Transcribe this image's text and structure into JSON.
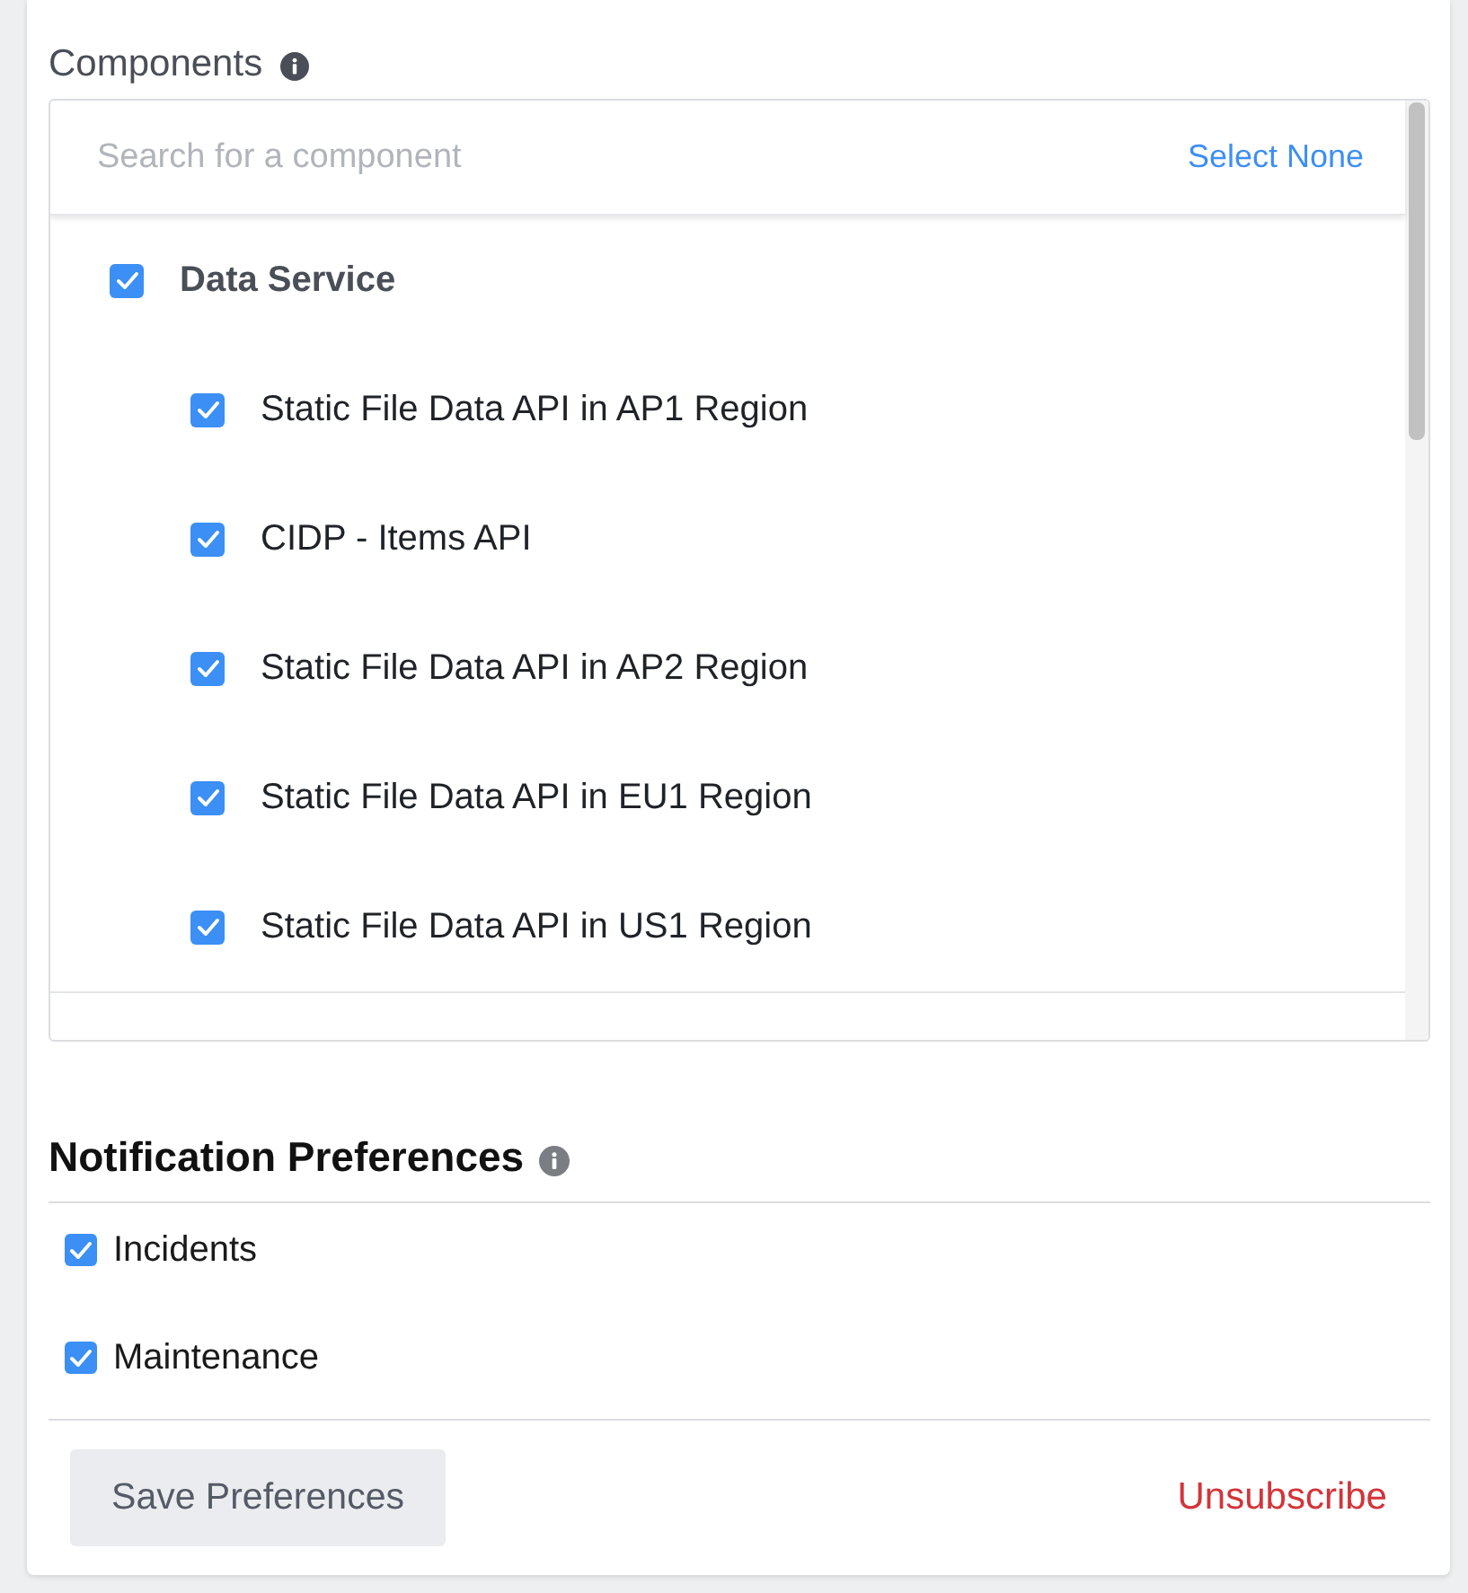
{
  "components": {
    "label": "Components",
    "search": {
      "placeholder": "Search for a component"
    },
    "select_none": "Select None",
    "items": [
      {
        "label": "Data Service",
        "checked": true,
        "children": [
          {
            "label": "Static File Data API in AP1 Region",
            "checked": true
          },
          {
            "label": "CIDP - Items API",
            "checked": true
          },
          {
            "label": "Static File Data API in AP2 Region",
            "checked": true
          },
          {
            "label": "Static File Data API in EU1 Region",
            "checked": true
          },
          {
            "label": "Static File Data API in US1 Region",
            "checked": true
          }
        ]
      }
    ]
  },
  "notification_preferences": {
    "title": "Notification Preferences",
    "options": [
      {
        "label": "Incidents",
        "checked": true
      },
      {
        "label": "Maintenance",
        "checked": true
      }
    ]
  },
  "actions": {
    "save": "Save Preferences",
    "unsubscribe": "Unsubscribe"
  }
}
